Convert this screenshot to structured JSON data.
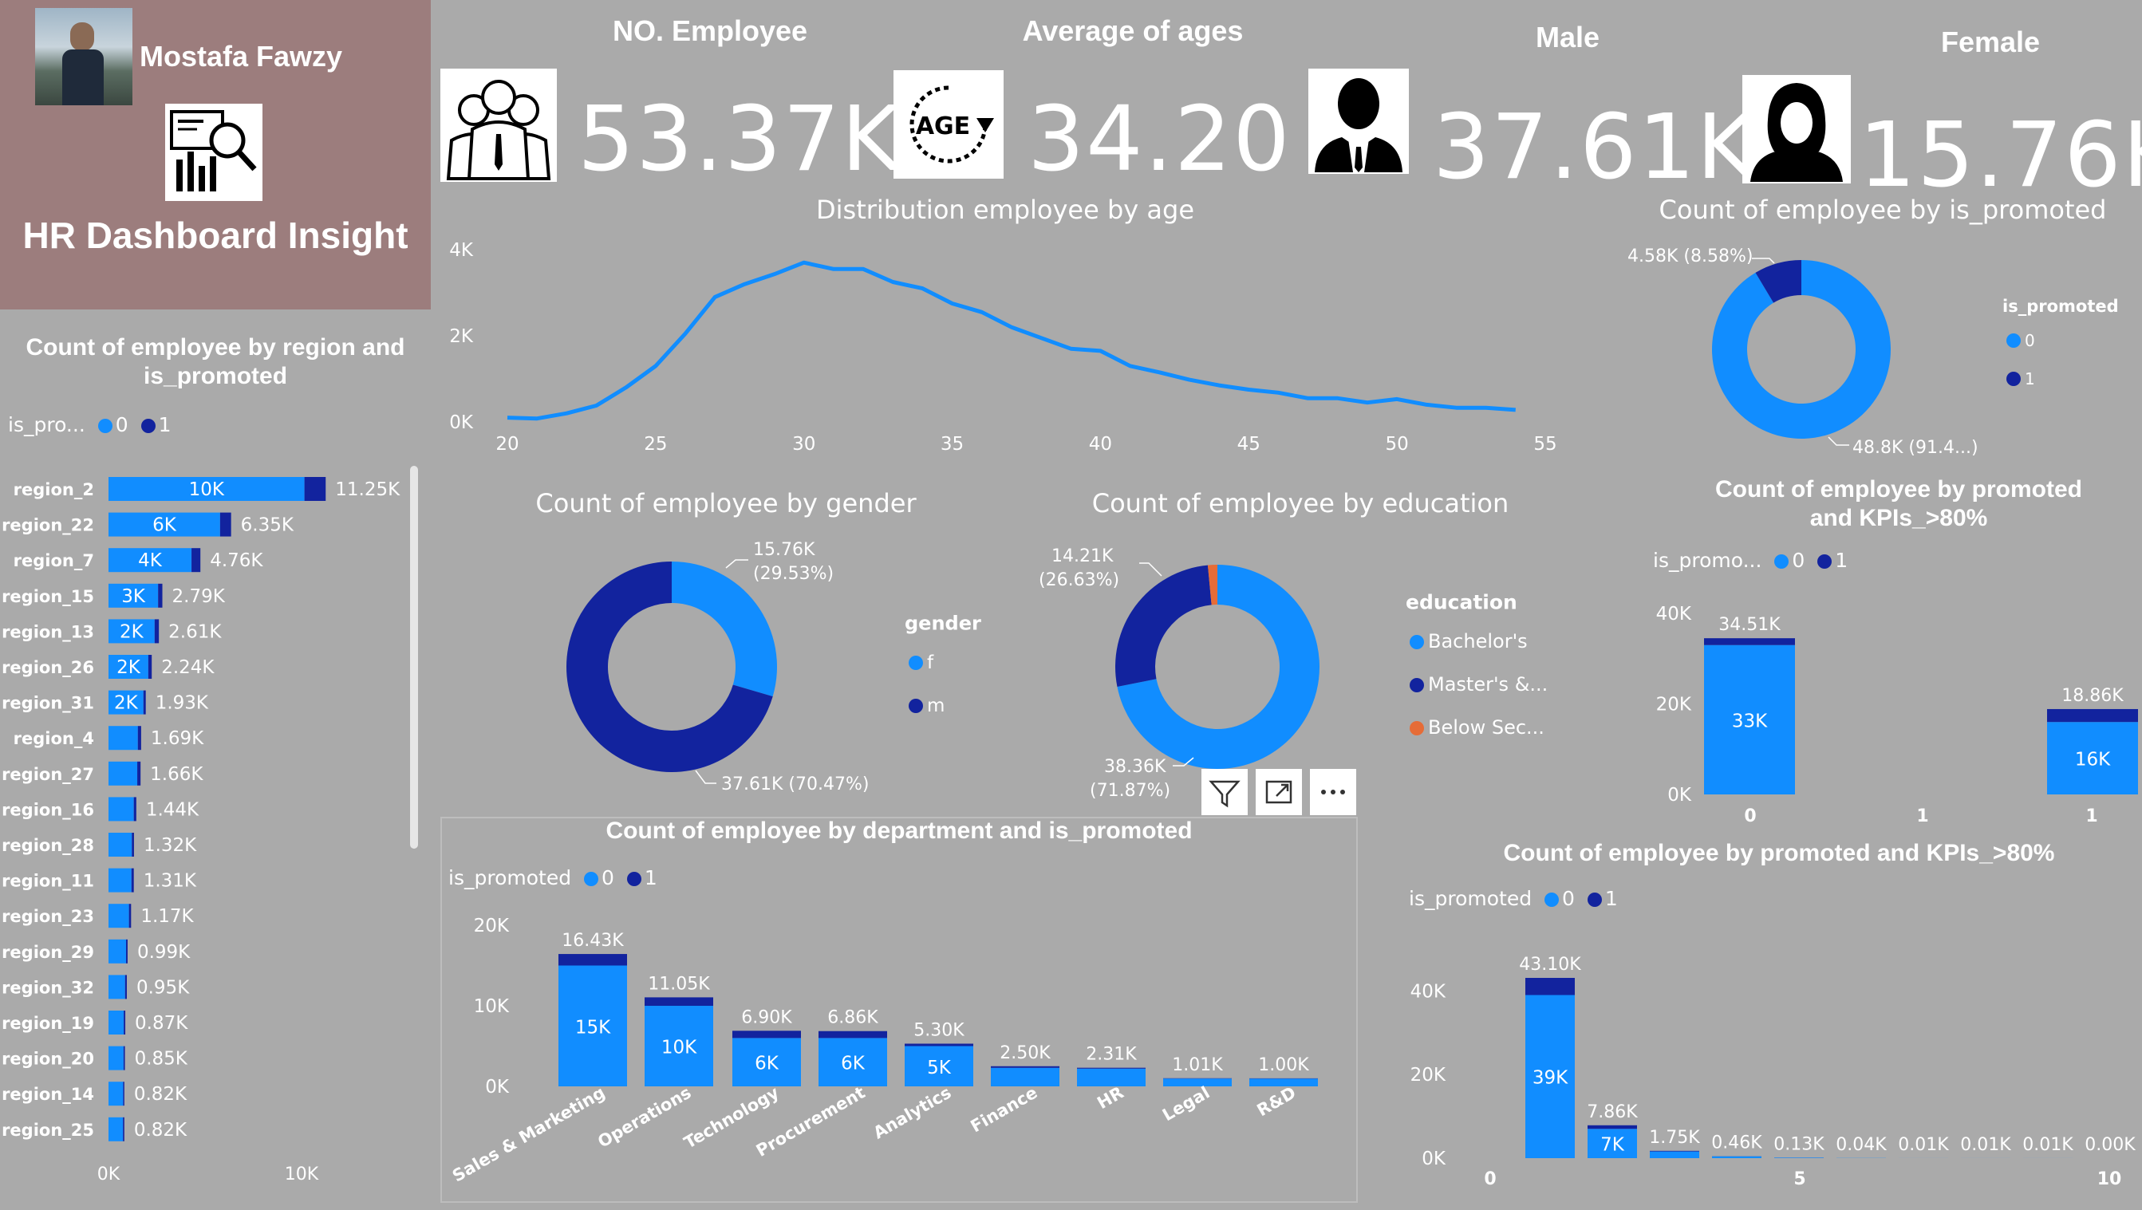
{
  "profile": {
    "name": "Mostafa Fawzy",
    "dashboard_title": "HR Dashboard Insight"
  },
  "kpis": {
    "employees": {
      "title": "NO. Employee",
      "value": "53.37K"
    },
    "age": {
      "title": "Average of ages",
      "value": "34.20",
      "icon_text": "AGE"
    },
    "male": {
      "title": "Male",
      "value": "37.61K"
    },
    "female": {
      "title": "Female",
      "value": "15.76K"
    }
  },
  "colors": {
    "series0": "#118dff",
    "series1": "#12239e",
    "orange": "#e66c37",
    "panel": "#9c7d7d",
    "background": "#aaaaaa"
  },
  "icons": [
    "user-avatar",
    "report-magnifier-icon",
    "team-icon",
    "age-icon",
    "male-person-icon",
    "female-person-icon",
    "filter-icon",
    "focus-mode-icon",
    "more-options-icon"
  ],
  "chart_data": [
    {
      "id": "region",
      "type": "bar",
      "title": "Count of employee by region and is_promoted",
      "legend_title": "is_pro...",
      "series_names": [
        "0",
        "1"
      ],
      "categories": [
        "region_2",
        "region_22",
        "region_7",
        "region_15",
        "region_13",
        "region_26",
        "region_31",
        "region_4",
        "region_27",
        "region_16",
        "region_28",
        "region_11",
        "region_23",
        "region_29",
        "region_32",
        "region_19",
        "region_20",
        "region_14",
        "region_25"
      ],
      "series": [
        {
          "name": "0",
          "values": [
            10.15,
            5.78,
            4.3,
            2.57,
            2.39,
            2.06,
            1.81,
            1.52,
            1.49,
            1.31,
            1.21,
            1.19,
            1.06,
            0.91,
            0.86,
            0.79,
            0.78,
            0.76,
            0.75
          ]
        },
        {
          "name": "1",
          "values": [
            1.1,
            0.57,
            0.46,
            0.22,
            0.22,
            0.18,
            0.12,
            0.17,
            0.17,
            0.13,
            0.11,
            0.12,
            0.11,
            0.08,
            0.09,
            0.08,
            0.07,
            0.06,
            0.07
          ]
        }
      ],
      "segment_labels": [
        "10K",
        "6K",
        "4K",
        "3K",
        "2K",
        "2K",
        "2K",
        "",
        "",
        "",
        "",
        "",
        "",
        "",
        "",
        "",
        "",
        "",
        ""
      ],
      "total_labels": [
        "11.25K",
        "6.35K",
        "4.76K",
        "2.79K",
        "2.61K",
        "2.24K",
        "1.93K",
        "1.69K",
        "1.66K",
        "1.44K",
        "1.32K",
        "1.31K",
        "1.17K",
        "0.99K",
        "0.95K",
        "0.87K",
        "0.85K",
        "0.82K",
        "0.82K"
      ],
      "x_ticks": [
        "0K",
        "10K"
      ],
      "xlim": [
        0,
        10
      ]
    },
    {
      "id": "age",
      "type": "line",
      "title": "Distribution employee by age",
      "x": [
        20,
        21,
        22,
        23,
        24,
        25,
        26,
        27,
        28,
        29,
        30,
        31,
        32,
        33,
        34,
        35,
        36,
        37,
        38,
        39,
        40,
        41,
        42,
        43,
        44,
        45,
        46,
        47,
        48,
        49,
        50,
        51,
        52,
        53,
        54
      ],
      "y": [
        0.1,
        0.08,
        0.2,
        0.38,
        0.8,
        1.3,
        2.05,
        2.9,
        3.2,
        3.43,
        3.7,
        3.55,
        3.55,
        3.25,
        3.1,
        2.75,
        2.55,
        2.2,
        1.95,
        1.7,
        1.65,
        1.3,
        1.15,
        0.98,
        0.85,
        0.75,
        0.68,
        0.55,
        0.55,
        0.45,
        0.53,
        0.4,
        0.33,
        0.33,
        0.28
      ],
      "x_ticks": [
        "20",
        "25",
        "30",
        "35",
        "40",
        "45",
        "50",
        "55"
      ],
      "y_ticks": [
        "0K",
        "2K",
        "4K"
      ],
      "xlim": [
        20,
        55
      ],
      "ylim": [
        0,
        4
      ]
    },
    {
      "id": "promoted",
      "type": "pie",
      "title": "Count of employee by is_promoted",
      "legend_title": "is_promoted",
      "labels": [
        "0",
        "1"
      ],
      "values": [
        48.8,
        4.58
      ],
      "data_labels": [
        "48.8K (91.4...)",
        "4.58K (8.58%)"
      ]
    },
    {
      "id": "gender",
      "type": "pie",
      "title": "Count of employee by gender",
      "legend_title": "gender",
      "labels": [
        "f",
        "m"
      ],
      "values": [
        15.76,
        37.61
      ],
      "data_labels": [
        "15.76K (29.53%)",
        "37.61K (70.47%)"
      ]
    },
    {
      "id": "education",
      "type": "pie",
      "title": "Count of employee by education",
      "legend_title": "education",
      "labels": [
        "Bachelor's",
        "Master's &...",
        "Below Sec..."
      ],
      "values": [
        38.36,
        14.21,
        0.8
      ],
      "data_labels": [
        "38.36K (71.87%)",
        "14.21K (26.63%)",
        ""
      ]
    },
    {
      "id": "kpi_promoted",
      "type": "bar",
      "title": "Count of employee by promoted and KPIs_>80%",
      "legend_title": "is_promo...",
      "series_names": [
        "0",
        "1"
      ],
      "categories": [
        "0",
        "1"
      ],
      "series": [
        {
          "name": "0",
          "values": [
            33.0,
            16.0
          ]
        },
        {
          "name": "1",
          "values": [
            1.51,
            2.86
          ]
        }
      ],
      "segment_labels": [
        "33K",
        "16K"
      ],
      "total_labels": [
        "34.51K",
        "18.86K"
      ],
      "x_ticks": [
        "0",
        "1",
        "1"
      ],
      "y_ticks": [
        "0K",
        "20K",
        "40K"
      ],
      "ylim": [
        0,
        40
      ]
    },
    {
      "id": "department",
      "type": "bar",
      "title": "Count of employee by department and is_promoted",
      "legend_title": "is_promoted",
      "series_names": [
        "0",
        "1"
      ],
      "categories": [
        "Sales & Marketing",
        "Operations",
        "Technology",
        "Procurement",
        "Analytics",
        "Finance",
        "HR",
        "Legal",
        "R&D"
      ],
      "series": [
        {
          "name": "0",
          "values": [
            15.0,
            10.0,
            6.0,
            6.0,
            5.0,
            2.3,
            2.2,
            0.97,
            0.96
          ]
        },
        {
          "name": "1",
          "values": [
            1.43,
            1.05,
            0.9,
            0.86,
            0.3,
            0.2,
            0.11,
            0.04,
            0.04
          ]
        }
      ],
      "segment_labels": [
        "15K",
        "10K",
        "6K",
        "6K",
        "5K",
        "",
        "",
        "",
        ""
      ],
      "total_labels": [
        "16.43K",
        "11.05K",
        "6.90K",
        "6.86K",
        "5.30K",
        "2.50K",
        "2.31K",
        "1.01K",
        "1.00K"
      ],
      "y_ticks": [
        "0K",
        "10K",
        "20K"
      ],
      "ylim": [
        0,
        20
      ]
    },
    {
      "id": "trainings",
      "type": "bar",
      "title": "Count of employee by promoted and KPIs_>80%",
      "legend_title": "is_promoted",
      "series_names": [
        "0",
        "1"
      ],
      "x": [
        1,
        2,
        3,
        4,
        5,
        6,
        7,
        8,
        9,
        10
      ],
      "series": [
        {
          "name": "0",
          "values": [
            39.0,
            7.0,
            1.6,
            0.44,
            0.12,
            0.04,
            0.01,
            0.01,
            0.01,
            0.0
          ]
        },
        {
          "name": "1",
          "values": [
            4.1,
            0.86,
            0.15,
            0.02,
            0.01,
            0.0,
            0.0,
            0.0,
            0.0,
            0.0
          ]
        }
      ],
      "segment_labels": [
        "39K",
        "7K",
        "",
        "",
        "",
        "",
        "",
        "",
        "",
        ""
      ],
      "total_labels": [
        "43.10K",
        "7.86K",
        "1.75K",
        "0.46K",
        "0.13K",
        "0.04K",
        "0.01K",
        "0.01K",
        "0.01K",
        "0.00K"
      ],
      "x_ticks": [
        "0",
        "5",
        "10"
      ],
      "y_ticks": [
        "0K",
        "20K",
        "40K"
      ],
      "xlim": [
        0,
        10
      ],
      "ylim": [
        0,
        43.1
      ]
    }
  ]
}
